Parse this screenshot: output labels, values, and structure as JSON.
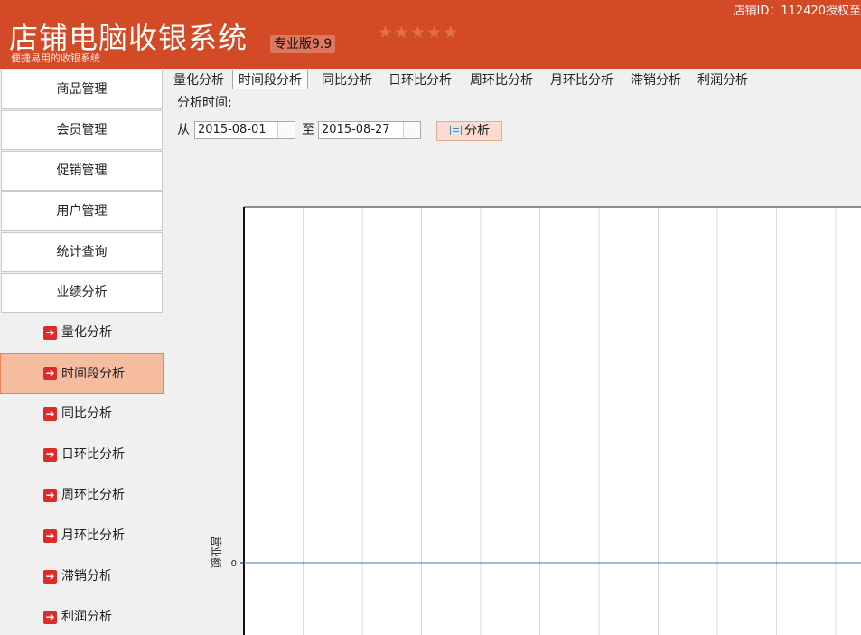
{
  "header": {
    "app_title": "店铺电脑收银系统",
    "edition": "专业版9.9",
    "subtitle": "便捷易用的收银系统",
    "stars": "★★★★★",
    "store_id": "店铺ID：112420授权至"
  },
  "sidebar": {
    "menu": [
      {
        "label": "商品管理"
      },
      {
        "label": "会员管理"
      },
      {
        "label": "促销管理"
      },
      {
        "label": "用户管理"
      },
      {
        "label": "统计查询"
      },
      {
        "label": "业绩分析"
      }
    ],
    "submenu": [
      {
        "label": "量化分析"
      },
      {
        "label": "时间段分析",
        "active": true
      },
      {
        "label": "同比分析"
      },
      {
        "label": "日环比分析"
      },
      {
        "label": "周环比分析"
      },
      {
        "label": "月环比分析"
      },
      {
        "label": "滞销分析"
      },
      {
        "label": "利润分析"
      }
    ]
  },
  "tabs": [
    {
      "label": "量化分析"
    },
    {
      "label": "时间段分析",
      "active": true
    },
    {
      "label": "同比分析"
    },
    {
      "label": "日环比分析"
    },
    {
      "label": "周环比分析"
    },
    {
      "label": "月环比分析"
    },
    {
      "label": "滞销分析"
    },
    {
      "label": "利润分析"
    }
  ],
  "filter": {
    "analysis_time_label": "分析时间:",
    "from_label": "从",
    "from_date": "2015-08-01",
    "to_label": "至",
    "to_date": "2015-08-27",
    "analyze_button": "分析"
  },
  "colors": {
    "header_bg": "#d34a27",
    "active_bg": "#f6bca0",
    "arrow_red": "#dc2b2b",
    "series_line": "#6d8fc9"
  },
  "chart_data": {
    "type": "line",
    "ylabel": "营业额",
    "y_ticks": [
      "0"
    ],
    "series": [
      {
        "values": [
          0,
          0
        ]
      }
    ],
    "grid": true
  }
}
